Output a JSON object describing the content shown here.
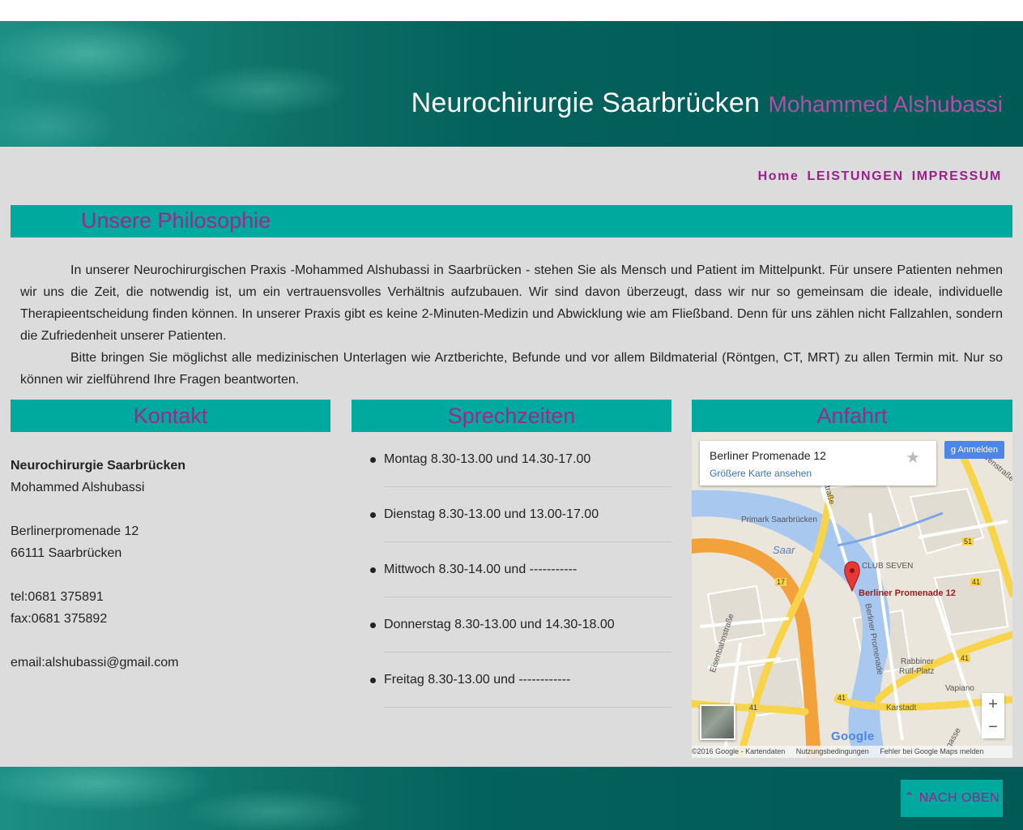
{
  "site": {
    "title": "Neurochirurgie Saarbrücken",
    "owner": "Mohammed Alshubassi"
  },
  "nav": {
    "home": "Home",
    "leistungen": "LEISTUNGEN",
    "impressum": "IMPRESSUM"
  },
  "philosophy": {
    "heading": "Unsere Philosophie",
    "paragraphs": [
      "In unserer Neurochirurgischen Praxis -Mohammed Alshubassi in Saarbrücken - stehen Sie als Mensch und Patient im Mittelpunkt. Für unsere Patienten nehmen wir uns die Zeit, die notwendig ist, um ein vertrauensvolles Verhältnis aufzubauen. Wir sind davon überzeugt, dass wir nur so gemeinsam die ideale, individuelle Therapieentscheidung finden können. In unserer Praxis gibt es keine 2-Minuten-Medizin und Abwicklung wie am Fließband. Denn für uns zählen nicht Fallzahlen, sondern die Zufriedenheit unserer Patienten.",
      "Bitte bringen Sie möglichst alle medizinischen Unterlagen wie Arztberichte, Befunde und vor allem Bildmaterial (Röntgen, CT, MRT) zu allen Termin mit. Nur so können wir zielführend Ihre Fragen beantworten."
    ]
  },
  "kontakt": {
    "heading": "Kontakt",
    "name": "Neurochirurgie Saarbrücken",
    "person": "Mohammed Alshubassi",
    "street": "Berlinerpromenade 12",
    "city": "66111 Saarbrücken",
    "tel": "tel:0681 375891",
    "fax": "fax:0681 375892",
    "email": "email:alshubassi@gmail.com"
  },
  "sprechzeiten": {
    "heading": "Sprechzeiten",
    "items": [
      "Montag 8.30-13.00 und 14.30-17.00",
      "Dienstag 8.30-13.00 und 13.00-17.00",
      "Mittwoch 8.30-14.00 und -----------",
      "Donnerstag 8.30-13.00 und 14.30-18.00",
      "Freitag 8.30-13.00 und ------------"
    ]
  },
  "anfahrt": {
    "heading": "Anfahrt",
    "map": {
      "card_address": "Berliner Promenade 12",
      "card_link": "Größere Karte ansehen",
      "signin": "Anmelden",
      "pin_label": "Berliner Promenade 12",
      "labels": {
        "primark": "Primark Saarbrücken",
        "club": "CLUB SEVEN",
        "saar": "Saar",
        "eisenbahn": "Eisenbahnstraße",
        "promenade": "Berliner Promenade",
        "rabbiner1": "Rabbiner",
        "rabbiner2": "Rülf-Platz",
        "vapiano": "Vapiano",
        "karstadt": "Karstadt",
        "strasse": "straße",
        "hoven": "thovenstraße",
        "gasse": "gasse"
      },
      "road_numbers": [
        "51",
        "17",
        "41",
        "41",
        "41",
        "41"
      ],
      "zoom_in": "+",
      "zoom_out": "−",
      "logo": "Google",
      "copyright": "©2016 Google - Kartendaten",
      "terms": "Nutzungsbedingungen",
      "report": "Fehler bei Google Maps melden"
    }
  },
  "back_to_top": "⌃ NACH OBEN",
  "colors": {
    "teal": "#00a99d",
    "purple": "#9b1f8e",
    "background": "#dcdcdc"
  }
}
